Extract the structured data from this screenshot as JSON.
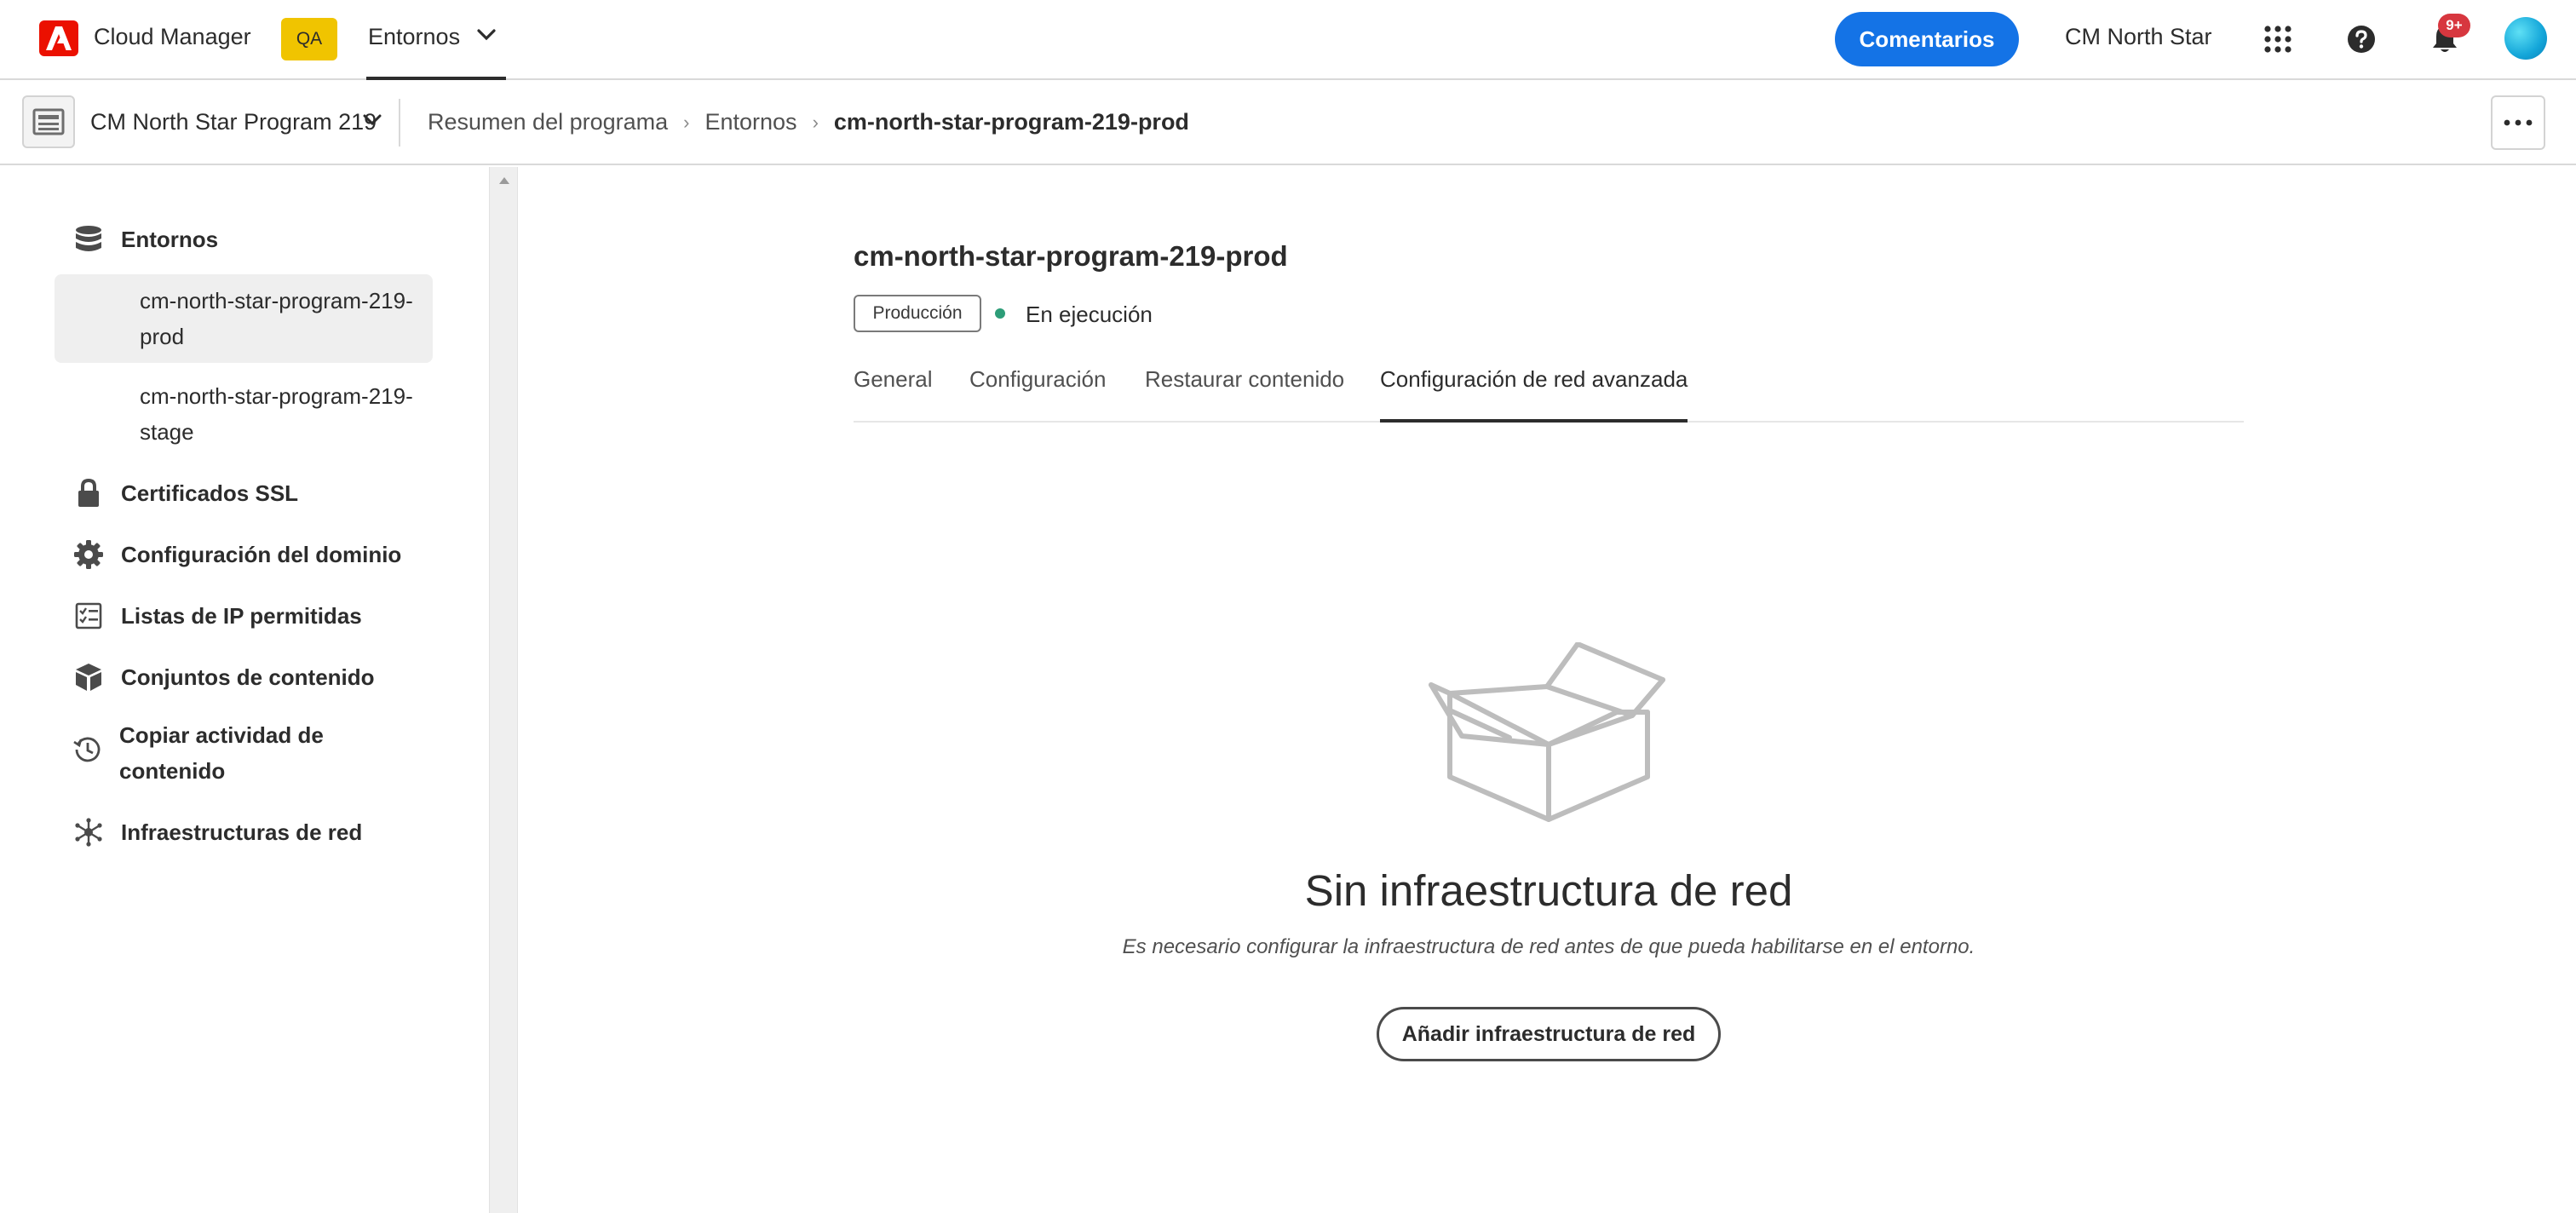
{
  "header": {
    "app_name": "Cloud Manager",
    "env_badge": "QA",
    "env_switch_label": "Entornos",
    "feedback_label": "Comentarios",
    "org_name": "CM North Star",
    "notification_count": "9+",
    "accent_color": "#1473e6",
    "brand_color": "#eb1000"
  },
  "subbar": {
    "program_name": "CM North Star Program 219",
    "breadcrumb": [
      {
        "label": "Resumen del programa"
      },
      {
        "label": "Entornos"
      },
      {
        "label": "cm-north-star-program-219-prod"
      }
    ]
  },
  "sidebar": {
    "items": [
      {
        "label": "Entornos",
        "icon": "database-icon"
      },
      {
        "label": "Certificados SSL",
        "icon": "lock-icon"
      },
      {
        "label": "Configuración del dominio",
        "icon": "gear-icon"
      },
      {
        "label": "Listas de IP permitidas",
        "icon": "checklist-icon"
      },
      {
        "label": "Conjuntos de contenido",
        "icon": "box-icon"
      },
      {
        "label": "Copiar actividad de contenido",
        "icon": "history-icon"
      },
      {
        "label": "Infraestructuras de red",
        "icon": "network-icon"
      }
    ],
    "environments": [
      {
        "label": "cm-north-star-program-219-prod",
        "selected": true
      },
      {
        "label": "cm-north-star-program-219-stage",
        "selected": false
      }
    ]
  },
  "main": {
    "env_title": "cm-north-star-program-219-prod",
    "env_tag": "Producción",
    "status": "En ejecución",
    "status_color": "#2d9d78",
    "tabs": [
      {
        "label": "General",
        "active": false
      },
      {
        "label": "Configuración",
        "active": false
      },
      {
        "label": "Restaurar contenido",
        "active": false
      },
      {
        "label": "Configuración de red avanzada",
        "active": true
      }
    ],
    "empty_state": {
      "icon": "open-box-icon",
      "title": "Sin infraestructura de red",
      "description": "Es necesario configurar la infraestructura de red antes de que pueda habilitarse en el entorno.",
      "button_label": "Añadir infraestructura de red"
    }
  }
}
